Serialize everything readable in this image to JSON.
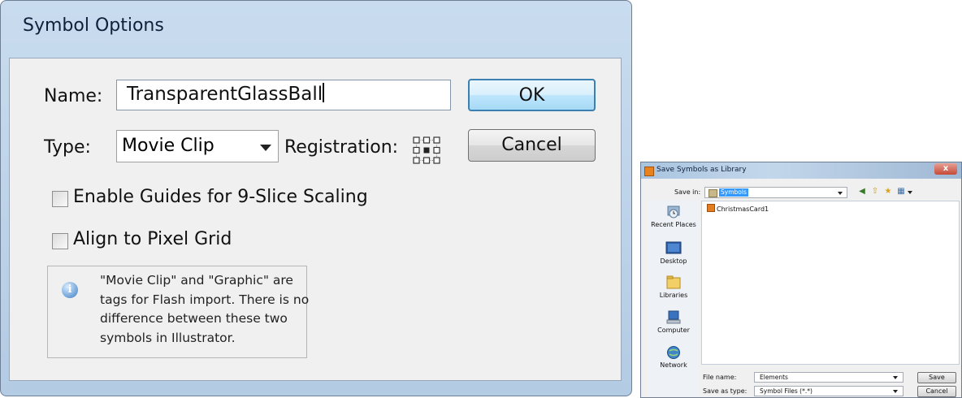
{
  "symbol_dialog": {
    "title": "Symbol Options",
    "name_label": "Name:",
    "name_value": "TransparentGlassBall",
    "type_label": "Type:",
    "type_value": "Movie Clip",
    "registration_label": "Registration:",
    "ok_label": "OK",
    "cancel_label": "Cancel",
    "enable_guides_label": "Enable Guides for 9-Slice Scaling",
    "enable_guides_checked": false,
    "align_pixel_label": "Align to Pixel Grid",
    "align_pixel_checked": false,
    "info_text": "\"Movie Clip\" and \"Graphic\" are tags for Flash import. There is no difference between these two symbols in Illustrator."
  },
  "save_dialog": {
    "title": "Save Symbols as Library",
    "close_label": "x",
    "save_in_label": "Save in:",
    "save_in_value": "Symbols",
    "places": [
      {
        "label": "Recent Places",
        "icon": "recent-places-icon"
      },
      {
        "label": "Desktop",
        "icon": "desktop-icon"
      },
      {
        "label": "Libraries",
        "icon": "libraries-icon"
      },
      {
        "label": "Computer",
        "icon": "computer-icon"
      },
      {
        "label": "Network",
        "icon": "network-icon"
      }
    ],
    "files": [
      "ChristmasCard1"
    ],
    "file_name_label": "File name:",
    "file_name_value": "Elements",
    "save_as_type_label": "Save as type:",
    "save_as_type_value": "Symbol Files (*.*)",
    "save_label": "Save",
    "cancel_label": "Cancel"
  }
}
